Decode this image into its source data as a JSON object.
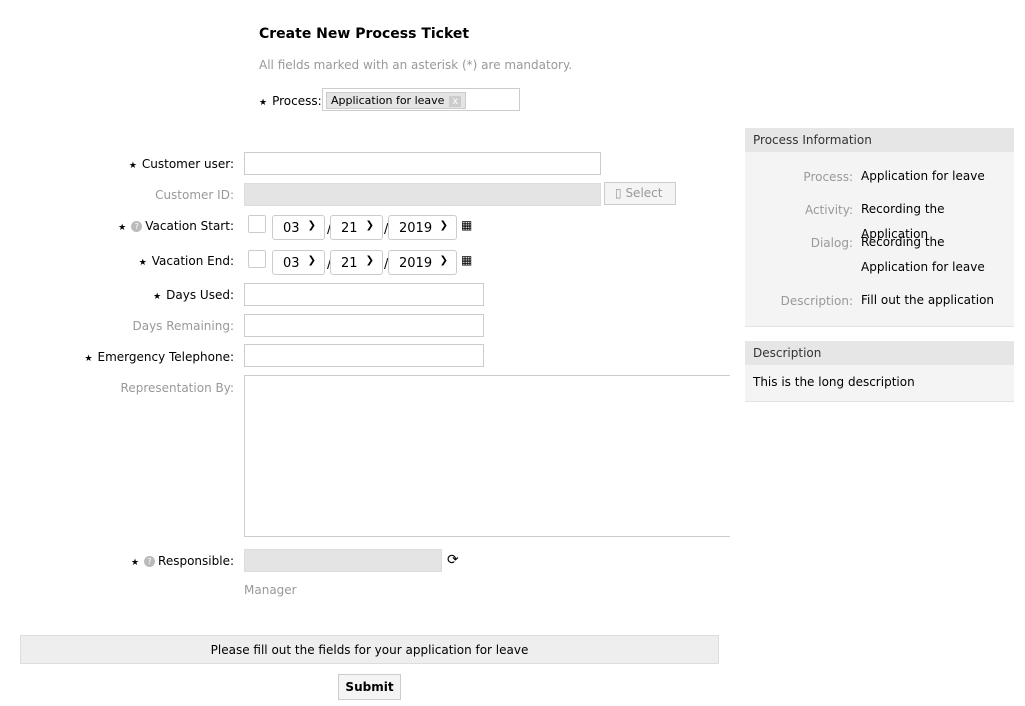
{
  "header": {
    "title": "Create New Process Ticket",
    "mandatory_note": "All fields marked with an asterisk (*) are mandatory."
  },
  "process": {
    "label": "Process:",
    "value": "Application for leave",
    "remove": "x"
  },
  "form": {
    "customer_user": {
      "label": "Customer user:",
      "value": ""
    },
    "customer_id": {
      "label": "Customer ID:",
      "select_label": "Select"
    },
    "vacation_start": {
      "label": "Vacation Start:",
      "month": "03",
      "day": "21",
      "year": "2019"
    },
    "vacation_end": {
      "label": "Vacation End:",
      "month": "03",
      "day": "21",
      "year": "2019"
    },
    "days_used": {
      "label": "Days Used:",
      "value": ""
    },
    "days_remaining": {
      "label": "Days Remaining:",
      "value": ""
    },
    "emergency_telephone": {
      "label": "Emergency Telephone:",
      "value": ""
    },
    "representation_by": {
      "label": "Representation By:",
      "value": ""
    },
    "responsible": {
      "label": "Responsible:",
      "hint": "Manager"
    },
    "footer_message": "Please fill out the fields for your application for leave",
    "submit_label": "Submit"
  },
  "process_info": {
    "title": "Process Information",
    "rows": [
      {
        "key": "Process:",
        "value": "Application for leave"
      },
      {
        "key": "Activity:",
        "value": "Recording the Application"
      },
      {
        "key": "Dialog:",
        "value": "Recording the Application for leave"
      },
      {
        "key": "Description:",
        "value": "Fill out the application"
      }
    ]
  },
  "description": {
    "title": "Description",
    "text": "This is the long description"
  }
}
